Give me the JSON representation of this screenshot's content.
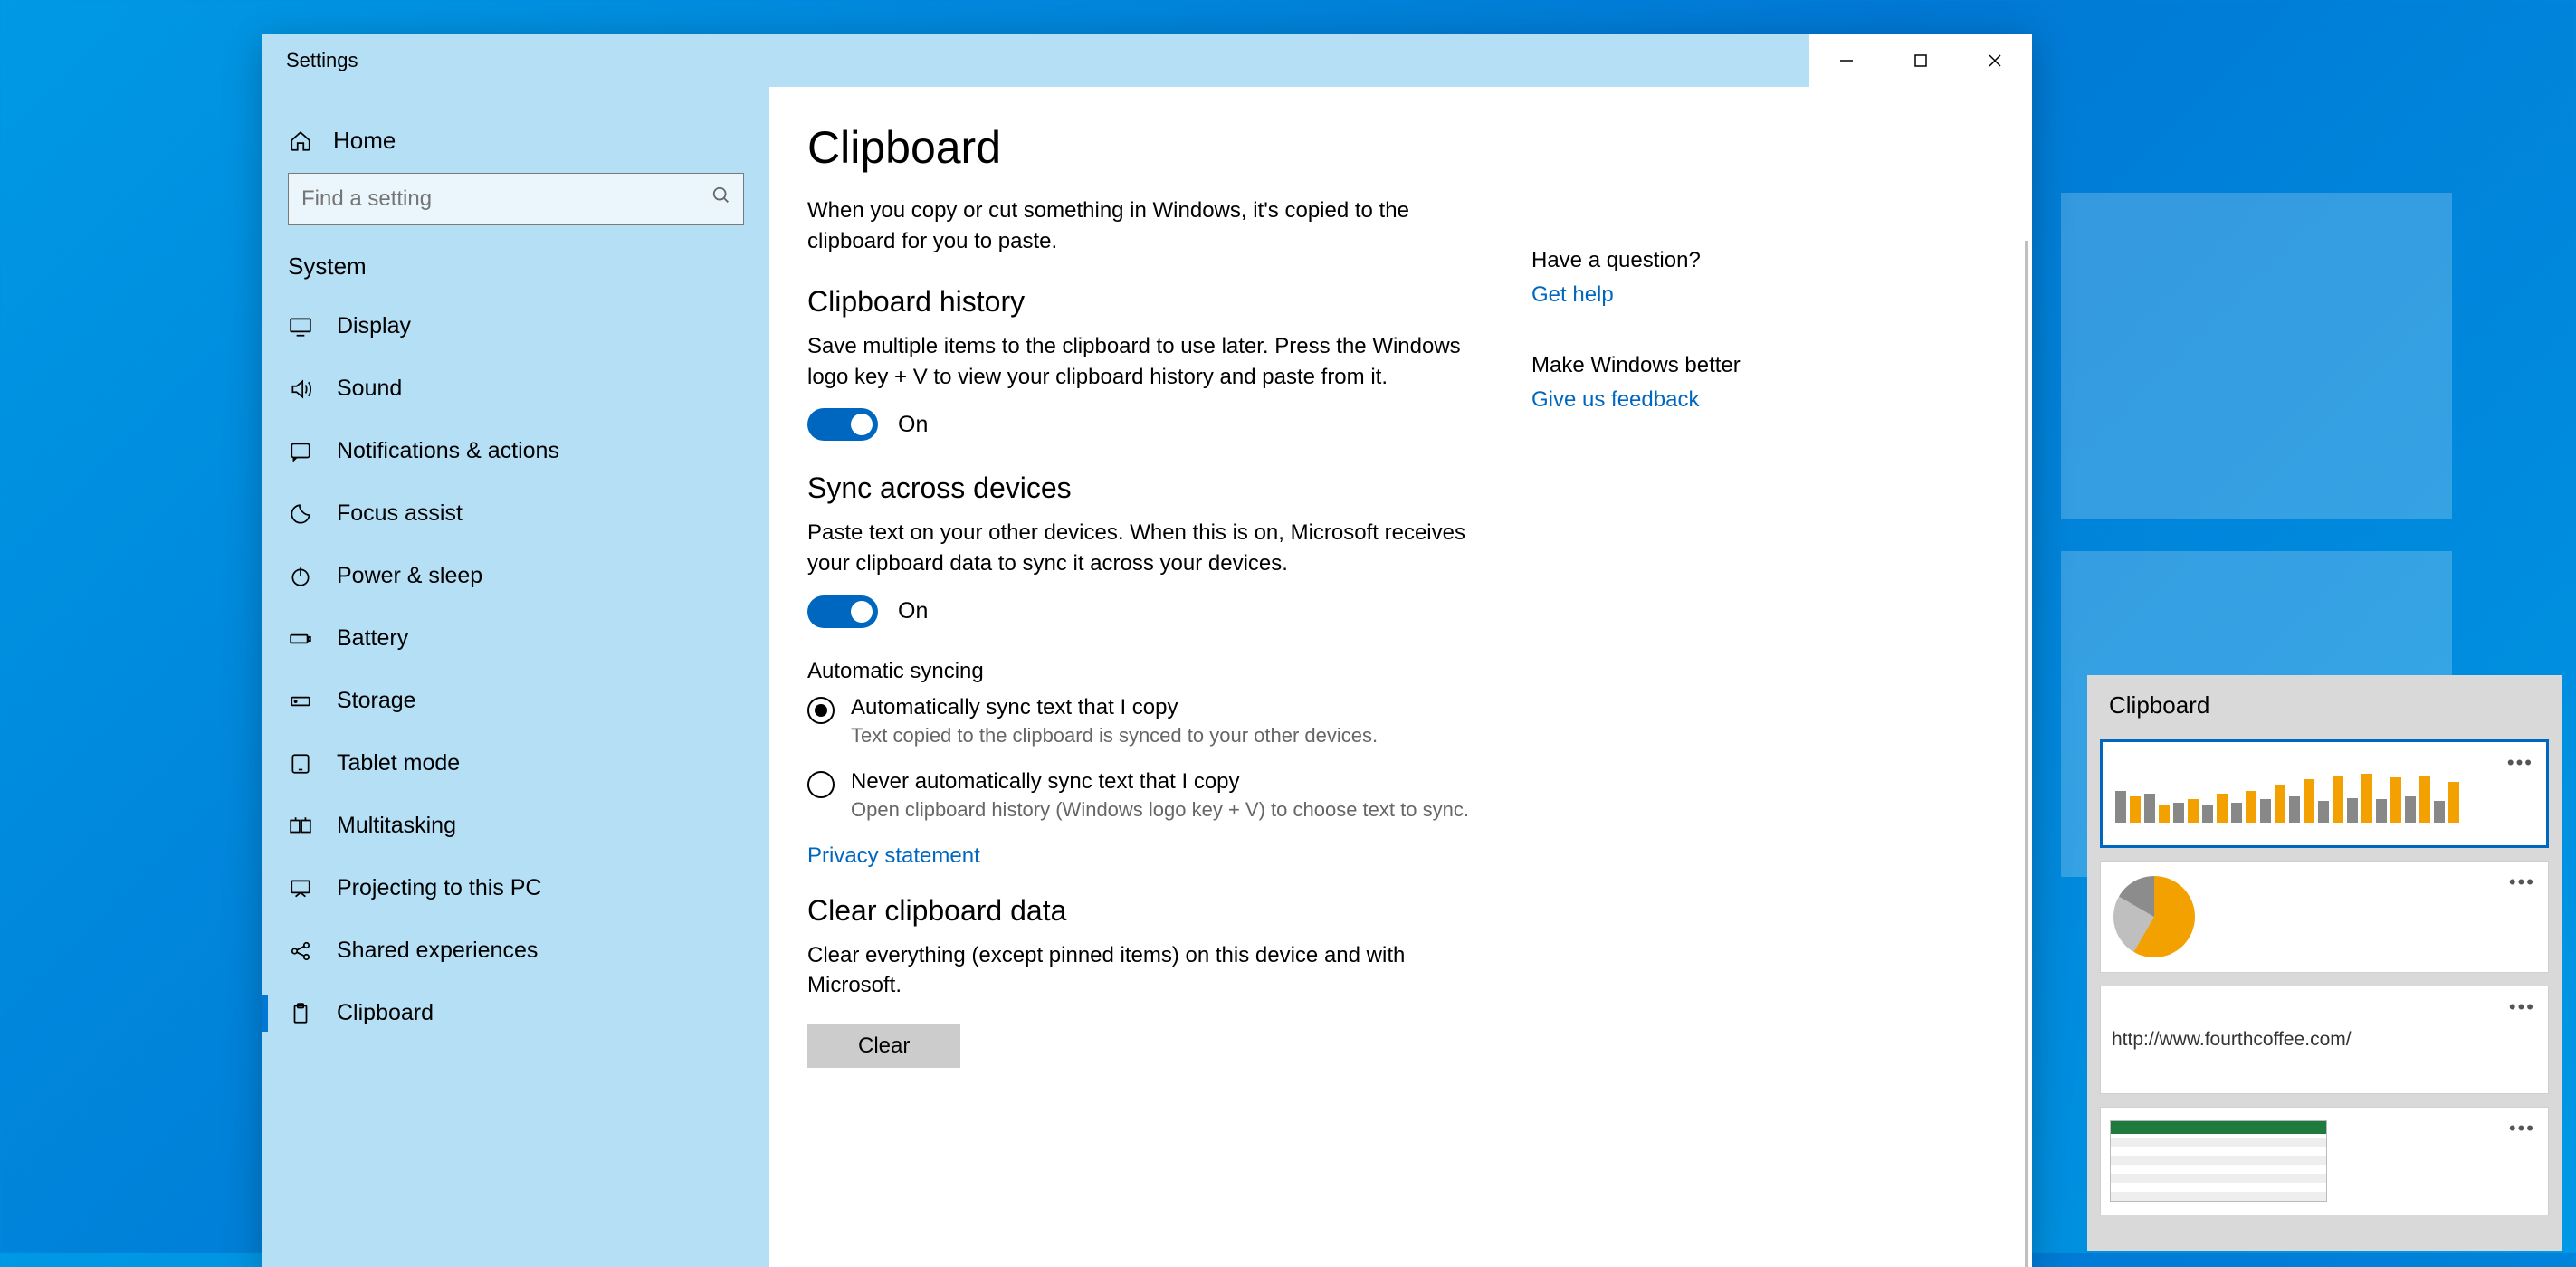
{
  "window": {
    "title": "Settings"
  },
  "home_label": "Home",
  "search_placeholder": "Find a setting",
  "category_label": "System",
  "nav": [
    {
      "label": "Display"
    },
    {
      "label": "Sound"
    },
    {
      "label": "Notifications & actions"
    },
    {
      "label": "Focus assist"
    },
    {
      "label": "Power & sleep"
    },
    {
      "label": "Battery"
    },
    {
      "label": "Storage"
    },
    {
      "label": "Tablet mode"
    },
    {
      "label": "Multitasking"
    },
    {
      "label": "Projecting to this PC"
    },
    {
      "label": "Shared experiences"
    },
    {
      "label": "Clipboard"
    }
  ],
  "page": {
    "title": "Clipboard",
    "lead": "When you copy or cut something in Windows, it's copied to the clipboard for you to paste.",
    "history": {
      "title": "Clipboard history",
      "desc": "Save multiple items to the clipboard to use later. Press the Windows logo key + V to view your clipboard history and paste from it.",
      "toggle_state": "On"
    },
    "sync": {
      "title": "Sync across devices",
      "desc": "Paste text on your other devices. When this is on, Microsoft receives your clipboard data to sync it across your devices.",
      "toggle_state": "On",
      "auto_label": "Automatic syncing",
      "opt_auto": {
        "label": "Automatically sync text that I copy",
        "desc": "Text copied to the clipboard is synced to your other devices."
      },
      "opt_never": {
        "label": "Never automatically sync text that I copy",
        "desc": "Open clipboard history (Windows logo key + V) to choose text to sync."
      },
      "privacy_link": "Privacy statement"
    },
    "clear": {
      "title": "Clear clipboard data",
      "desc": "Clear everything (except pinned items) on this device and with Microsoft.",
      "button": "Clear"
    }
  },
  "aside": {
    "q_title": "Have a question?",
    "q_link": "Get help",
    "fb_title": "Make Windows better",
    "fb_link": "Give us feedback"
  },
  "clipboard_flyout": {
    "title": "Clipboard",
    "items": [
      {
        "kind": "chart-bar"
      },
      {
        "kind": "chart-pie"
      },
      {
        "kind": "text",
        "text": "http://www.fourthcoffee.com/"
      },
      {
        "kind": "spreadsheet"
      }
    ]
  }
}
